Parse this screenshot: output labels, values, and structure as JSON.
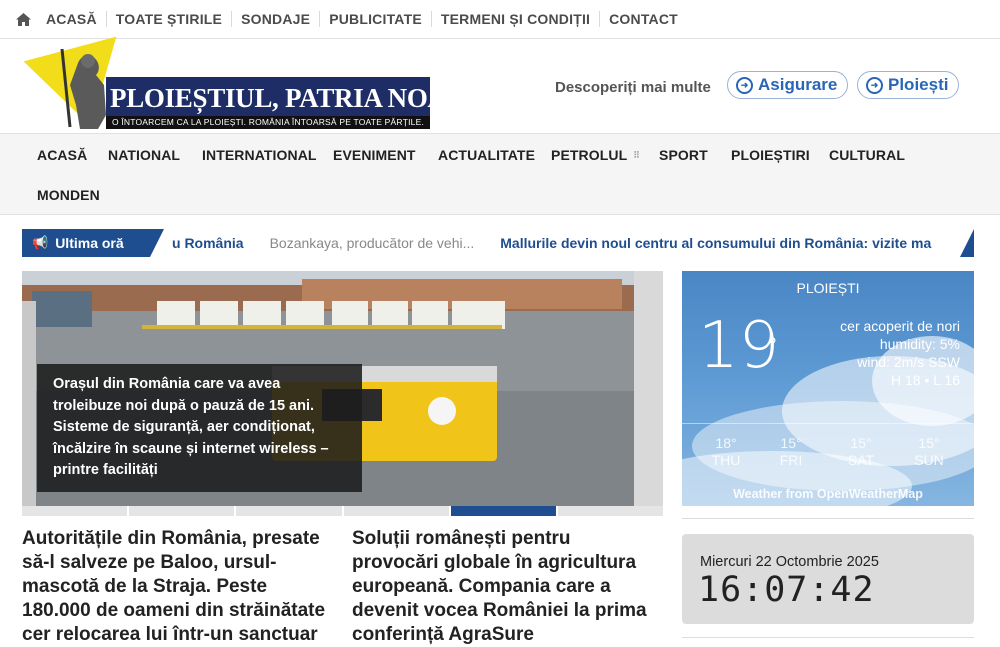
{
  "topbar": {
    "links": [
      "ACASĂ",
      "TOATE ȘTIRILE",
      "SONDAJE",
      "PUBLICITATE",
      "TERMENI ȘI CONDIȚII",
      "CONTACT"
    ]
  },
  "header": {
    "logo_title": "PLOIEȘTIUL, PATRIA NOASTRĂ",
    "logo_slogan": "O ÎNTOARCEM CA LA PLOIEȘTI. ROMÂNIA ÎNTOARSĂ PE TOATE PĂRȚILE.",
    "discover_label": "Descoperiți mai multe",
    "pills": [
      "Asigurare",
      "Ploiești"
    ]
  },
  "nav": {
    "items": [
      "ACASĂ",
      "NATIONAL",
      "INTERNATIONAL",
      "EVENIMENT",
      "ACTUALITATE",
      "PETROLUL",
      "SPORT",
      "PLOIEȘTIRI",
      "CULTURAL",
      "MONDEN"
    ]
  },
  "ticker": {
    "label": "Ultima oră",
    "items": [
      "u România",
      "Bozankaya, producător de vehi...",
      "Mallurile devin noul centru al consumului din România: vizite mai"
    ]
  },
  "featured": {
    "caption": "Orașul din România care va avea troleibuze noi după o pauză de 15 ani. Sisteme de siguranță, aer condiționat, încălzire în scaune și internet wireless – printre facilități",
    "slides": 6,
    "active_slide": 5
  },
  "articles": [
    {
      "title": "Autoritățile din România, presate să-l salveze pe Baloo, ursul-mascotă de la Straja. Peste 180.000 de oameni din străinătate cer relocarea lui într-un sanctuar"
    },
    {
      "title": "Soluții românești pentru provocări globale în agricultura europeană. Compania care a devenit vocea României la prima conferință AgraSure"
    }
  ],
  "weather": {
    "city": "PLOIEȘTI",
    "temp": "19",
    "deg": "°",
    "desc": "cer acoperit de nori",
    "humidity": "humidity: 5%",
    "wind": "wind: 2m/s SSW",
    "hl": "H 18 • L 16",
    "forecast": [
      {
        "t": "18°",
        "d": "THU"
      },
      {
        "t": "15°",
        "d": "FRI"
      },
      {
        "t": "15°",
        "d": "SAT"
      },
      {
        "t": "15°",
        "d": "SUN"
      }
    ],
    "source": "Weather from OpenWeatherMap"
  },
  "clock": {
    "date": "Miercuri 22 Octombrie 2025",
    "time": "16:07:42"
  },
  "colors": {
    "brand_blue": "#1f4e90",
    "logo_yellow": "#f2dd1a",
    "pill_blue": "#2a66b5"
  }
}
